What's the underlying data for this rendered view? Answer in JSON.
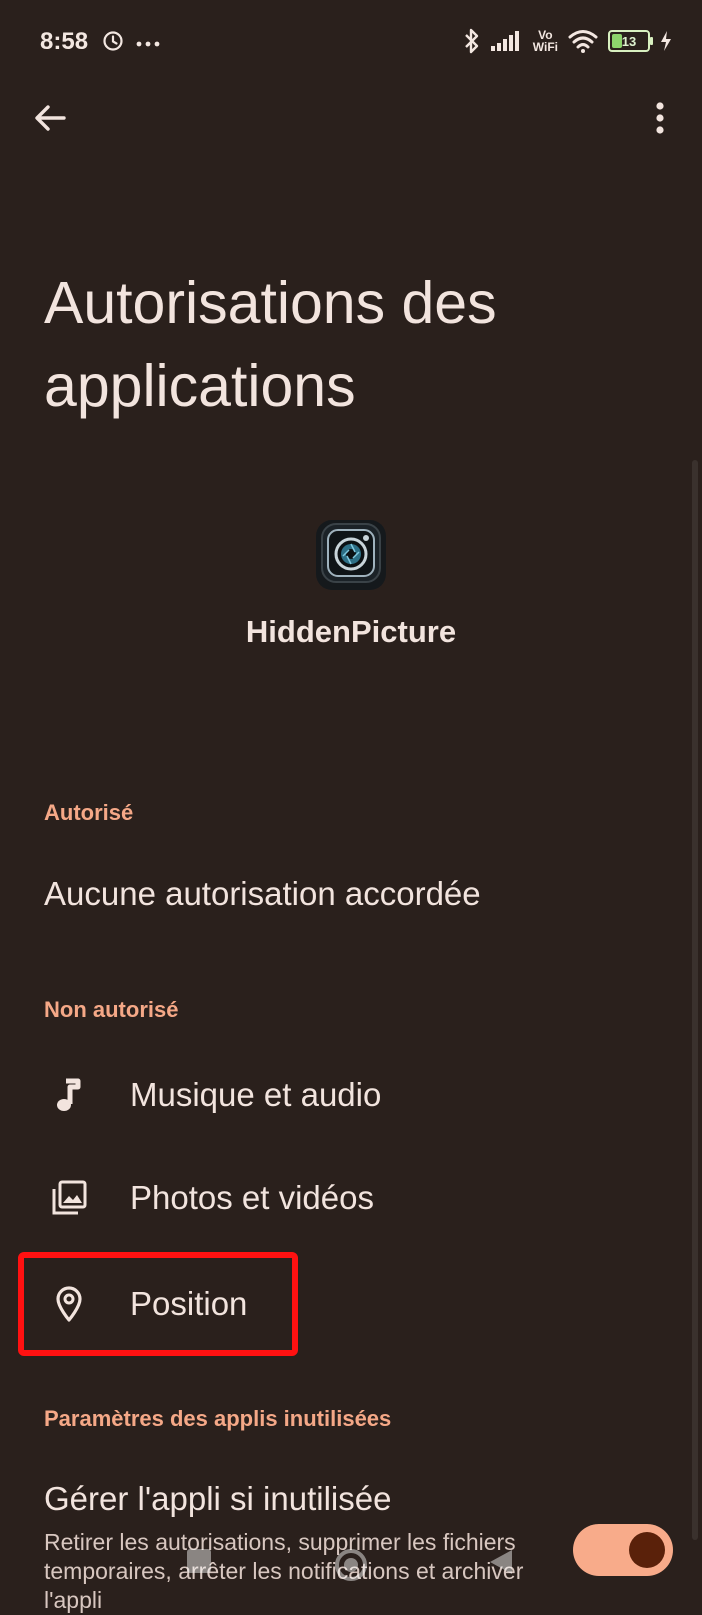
{
  "status_bar": {
    "time": "8:58",
    "battery_level": "13",
    "network_label_top": "Vo",
    "network_label_bottom": "WiFi",
    "signal_strength": 4
  },
  "header": {
    "title": "Autorisations des applications"
  },
  "app": {
    "name": "HiddenPicture",
    "icon": "camera-lens-icon"
  },
  "sections": {
    "allowed": {
      "label": "Autorisé",
      "empty_text": "Aucune autorisation accordée"
    },
    "denied": {
      "label": "Non autorisé",
      "items": [
        {
          "label": "Musique et audio",
          "icon": "music-note-icon"
        },
        {
          "label": "Photos et vidéos",
          "icon": "photo-library-icon"
        },
        {
          "label": "Position",
          "icon": "location-pin-icon",
          "highlighted": true
        }
      ]
    },
    "unused": {
      "label": "Paramètres des applis inutilisées",
      "item_title": "Gérer l'appli si inutilisée",
      "item_description": "Retirer les autorisations, supprimer les fichiers temporaires, arrêter les notifications et archiver l'appli",
      "toggle_on": true
    }
  },
  "colors": {
    "background": "#2a201c",
    "accent": "#f5a887",
    "text": "#f2e4de",
    "highlight": "#ff1111",
    "toggle_track": "#f8ab8a",
    "toggle_knob": "#5a210a"
  }
}
